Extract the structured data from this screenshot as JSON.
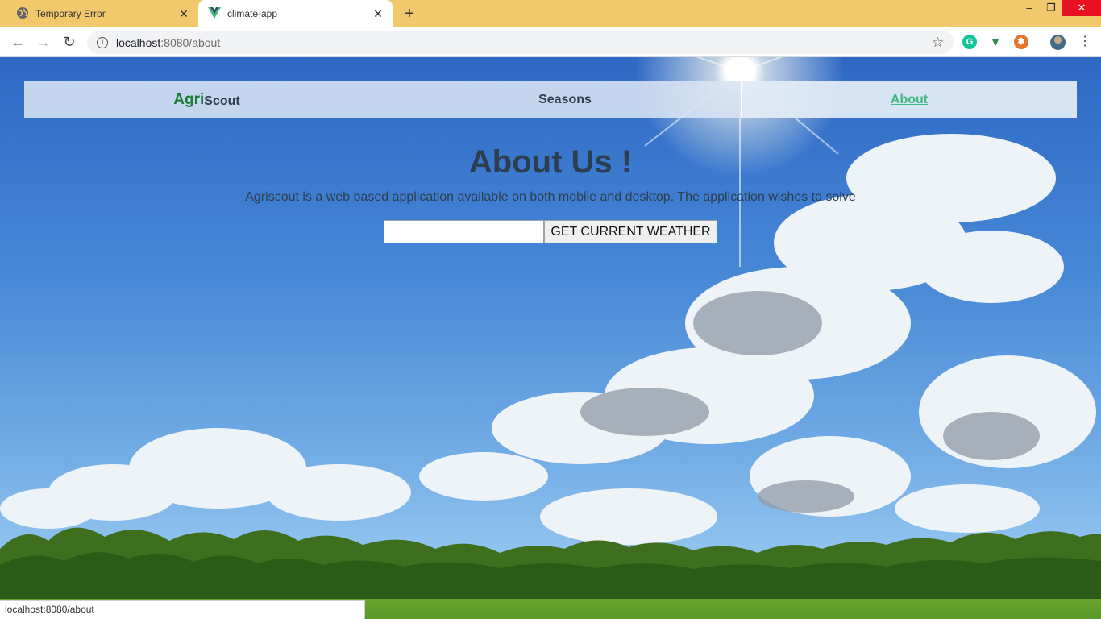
{
  "browser": {
    "tabs": [
      {
        "title": "Temporary Error",
        "icon": "globe-icon",
        "active": false
      },
      {
        "title": "climate-app",
        "icon": "vue-logo-icon",
        "active": true
      }
    ],
    "new_tab": "+",
    "window_controls": {
      "minimize": "–",
      "maximize": "❐",
      "close": "✕"
    },
    "url_host": "localhost",
    "url_rest": ":8080/about",
    "extensions": [
      {
        "name": "grammarly-icon",
        "label": "G",
        "color": "#15c39a"
      },
      {
        "name": "vue-devtools-icon",
        "label": "▼",
        "color": "#2f8f5b"
      },
      {
        "name": "extension-orange-icon",
        "label": "✱",
        "color": "#e8742c"
      }
    ]
  },
  "nav": {
    "brand_part1": "Agri",
    "brand_part2": "Scout",
    "links": [
      {
        "label": "Seasons",
        "active": false
      },
      {
        "label": "About",
        "active": true
      }
    ]
  },
  "about": {
    "heading": "About Us !",
    "description": "Agriscout is a web based application available on both mobile and desktop. The application wishes to solve"
  },
  "weather_form": {
    "input_value": "",
    "button_label": "GET CURRENT WEATHER"
  },
  "status_bar": {
    "url": "localhost:8080/about"
  },
  "colors": {
    "tabstrip": "#f1c96c",
    "brand_green": "#1d7a35",
    "active_link": "#42b983",
    "text_dark": "#2c3e50"
  }
}
